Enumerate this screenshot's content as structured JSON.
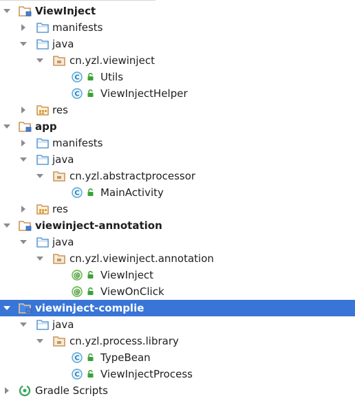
{
  "tree": {
    "modules": [
      {
        "name": "ViewInject",
        "selected": false,
        "children": [
          {
            "type": "folder",
            "label": "manifests",
            "expanded": false
          },
          {
            "type": "folder",
            "label": "java",
            "expanded": true
          },
          {
            "type": "package",
            "label": "cn.yzl.viewinject"
          },
          {
            "type": "class",
            "label": "Utils"
          },
          {
            "type": "class",
            "label": "ViewInjectHelper"
          },
          {
            "type": "res",
            "label": "res",
            "expanded": false
          }
        ]
      },
      {
        "name": "app",
        "selected": false,
        "children": [
          {
            "type": "folder",
            "label": "manifests",
            "expanded": false
          },
          {
            "type": "folder",
            "label": "java",
            "expanded": true
          },
          {
            "type": "package",
            "label": "cn.yzl.abstractprocessor"
          },
          {
            "type": "class",
            "label": "MainActivity"
          },
          {
            "type": "res",
            "label": "res",
            "expanded": false
          }
        ]
      },
      {
        "name": "viewinject-annotation",
        "selected": false,
        "children": [
          {
            "type": "folder",
            "label": "java",
            "expanded": true
          },
          {
            "type": "package",
            "label": "cn.yzl.viewinject.annotation"
          },
          {
            "type": "annotation",
            "label": "ViewInject"
          },
          {
            "type": "annotation",
            "label": "ViewOnClick"
          }
        ]
      },
      {
        "name": "viewinject-complie",
        "selected": true,
        "children": [
          {
            "type": "folder",
            "label": "java",
            "expanded": true
          },
          {
            "type": "package",
            "label": "cn.yzl.process.library"
          },
          {
            "type": "class",
            "label": "TypeBean"
          },
          {
            "type": "class",
            "label": "ViewInjectProcess"
          }
        ]
      }
    ],
    "gradle": {
      "label": "Gradle Scripts",
      "expanded": false
    }
  },
  "icons": {
    "module": "module-folder-icon",
    "folder": "folder-icon",
    "package": "package-icon",
    "res": "resource-folder-icon",
    "class": "class-c-icon",
    "annotation": "annotation-at-icon",
    "lock": "lock-icon",
    "gradle": "gradle-icon"
  },
  "colors": {
    "selection": "#3875d7",
    "folder_blue": "#5b9bd5",
    "package_tan": "#c9955a",
    "class_blue": "#4fa6d6",
    "annotation_green": "#62b543",
    "lock_green": "#3aa335",
    "arrow_gray": "#8c8c8c"
  }
}
